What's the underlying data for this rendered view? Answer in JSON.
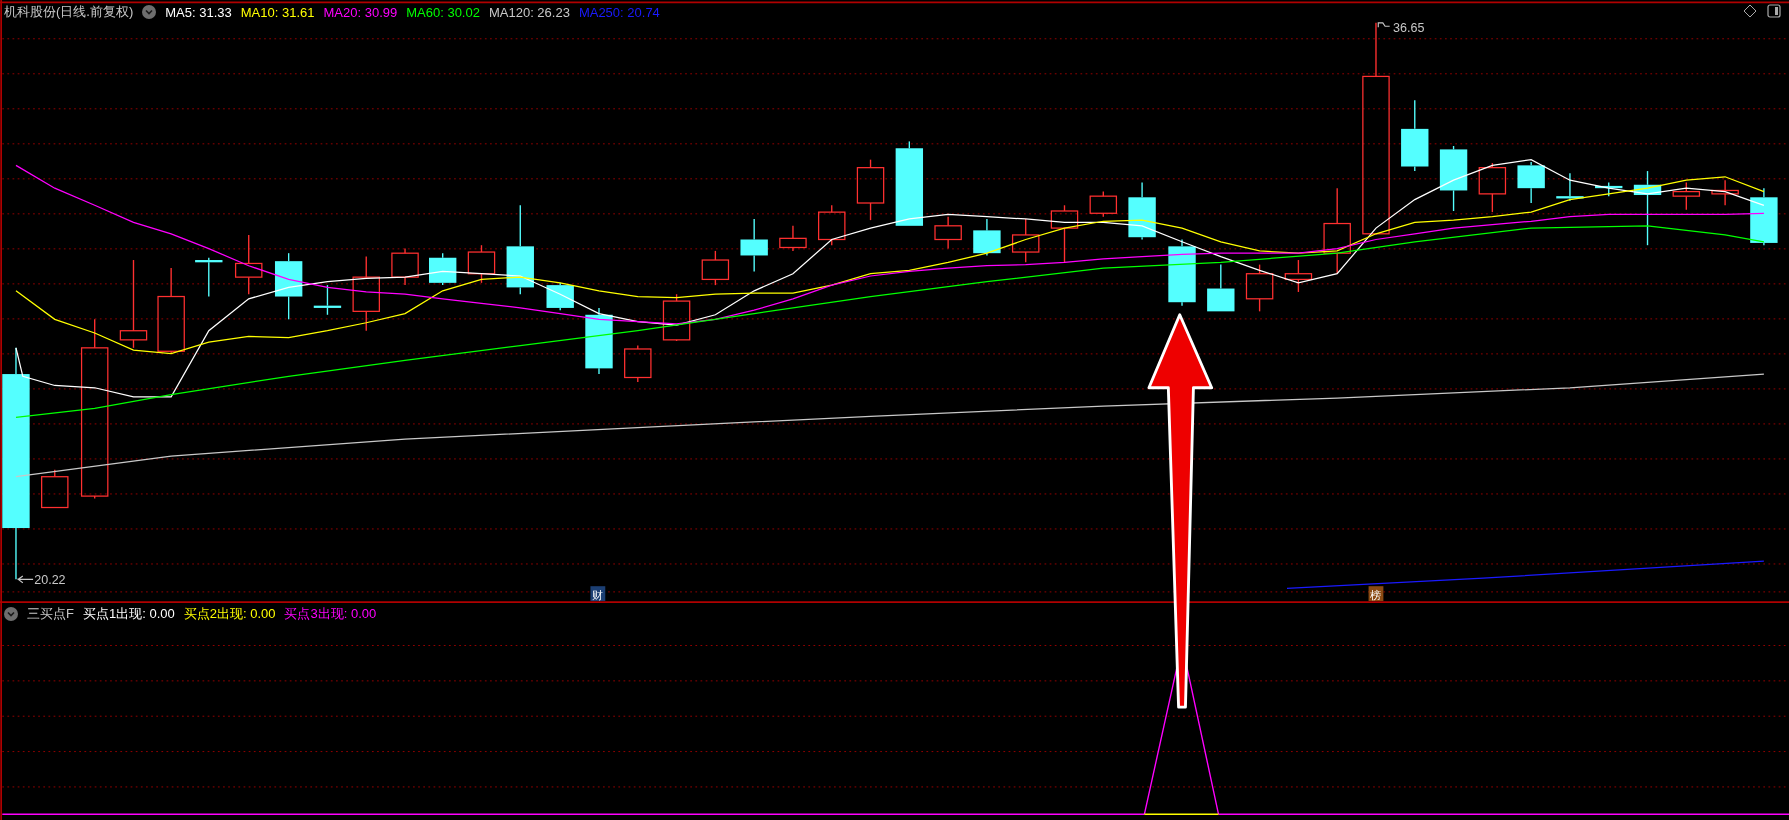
{
  "main_chart": {
    "title": "机科股份(日线.前复权)",
    "legend": [
      {
        "label": "MA5: 31.33",
        "color": "#ffffff"
      },
      {
        "label": "MA10: 31.61",
        "color": "#ffff00"
      },
      {
        "label": "MA20: 30.99",
        "color": "#ff00ff"
      },
      {
        "label": "MA60: 30.02",
        "color": "#00ff00"
      },
      {
        "label": "MA120: 26.23",
        "color": "#c8c8c8"
      },
      {
        "label": "MA250: 20.74",
        "color": "#1a1aff"
      }
    ],
    "high_label": "36.65",
    "low_label": "20.22",
    "event_markers": [
      {
        "label": "财",
        "color": "#1c3f73"
      },
      {
        "label": "榜",
        "color": "#8a4a12"
      }
    ]
  },
  "indicator_panel": {
    "title": "三买点F",
    "legend": [
      {
        "label": "买点1出现: 0.00",
        "color": "#ffffff"
      },
      {
        "label": "买点2出现: 0.00",
        "color": "#ffff00"
      },
      {
        "label": "买点3出现: 0.00",
        "color": "#ff00ff"
      }
    ]
  }
}
